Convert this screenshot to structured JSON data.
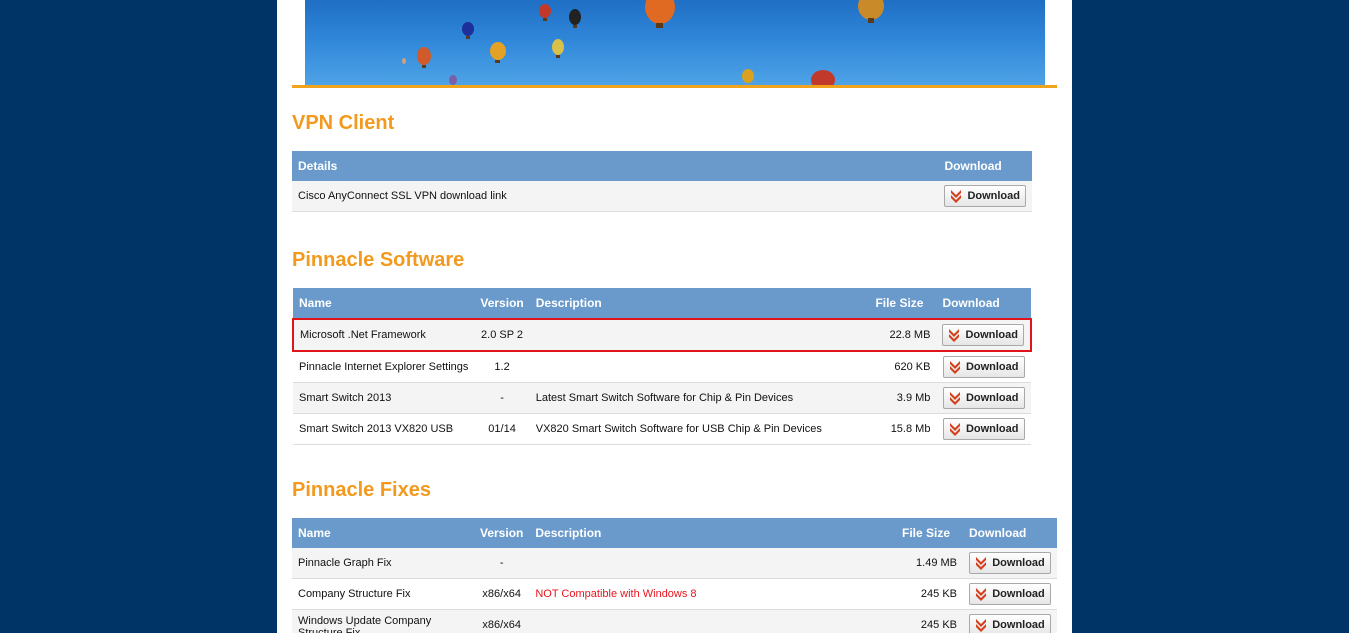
{
  "vpn": {
    "title": "VPN Client",
    "headers": {
      "details": "Details",
      "download": "Download"
    },
    "rows": [
      {
        "details": "Cisco AnyConnect SSL VPN download link",
        "button": "Download"
      }
    ]
  },
  "software": {
    "title": "Pinnacle Software",
    "headers": {
      "name": "Name",
      "version": "Version",
      "description": "Description",
      "size": "File Size",
      "download": "Download"
    },
    "rows": [
      {
        "name": "Microsoft .Net Framework",
        "version": "2.0 SP 2",
        "description": "",
        "size": "22.8 MB",
        "button": "Download",
        "highlighted": true
      },
      {
        "name": "Pinnacle Internet Explorer Settings",
        "version": "1.2",
        "description": "",
        "size": "620 KB",
        "button": "Download"
      },
      {
        "name": "Smart Switch 2013",
        "version": "-",
        "description": "Latest Smart Switch Software for Chip & Pin Devices",
        "size": "3.9 Mb",
        "button": "Download"
      },
      {
        "name": "Smart Switch 2013 VX820 USB",
        "version": "01/14",
        "description": "VX820 Smart Switch Software for USB Chip & Pin Devices",
        "size": "15.8 Mb",
        "button": "Download"
      }
    ]
  },
  "fixes": {
    "title": "Pinnacle Fixes",
    "headers": {
      "name": "Name",
      "version": "Version",
      "description": "Description",
      "size": "File Size",
      "download": "Download"
    },
    "rows": [
      {
        "name": "Pinnacle Graph Fix",
        "version": "-",
        "description": "",
        "size": "1.49 MB",
        "button": "Download"
      },
      {
        "name": "Company Structure Fix",
        "version": "x86/x64",
        "description": "NOT Compatible with Windows 8",
        "size": "245 KB",
        "button": "Download"
      },
      {
        "name": "Windows Update Company Structure Fix",
        "version": "x86/x64",
        "description": "",
        "size": "245 KB",
        "button": "Download"
      }
    ]
  },
  "colors": {
    "background": "#003366",
    "accent": "#f39a1e",
    "table_header": "#6a9acb",
    "highlight": "#e0141b",
    "warning": "#e8151e"
  },
  "icons": {
    "download": "double-chevron-down-icon"
  }
}
